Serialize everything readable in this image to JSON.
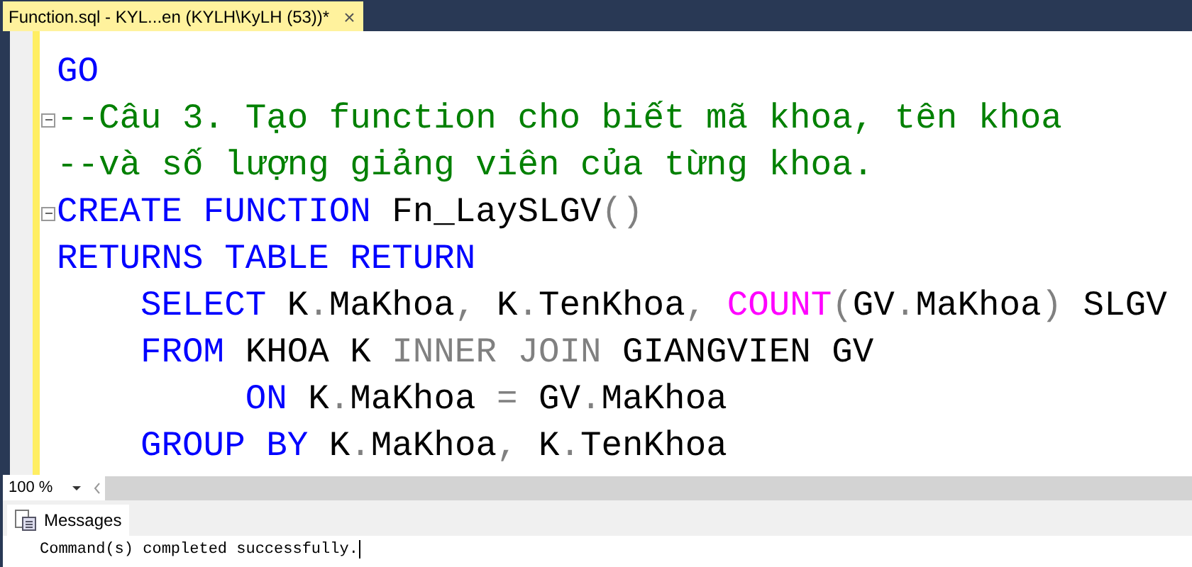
{
  "document_tab": {
    "title": "Function.sql - KYL...en (KYLH\\KyLH (53))*",
    "close": "×",
    "selected": true
  },
  "editor": {
    "lines": [
      {
        "fold": false,
        "tokens": [
          {
            "kind": "keyword",
            "text": "GO"
          }
        ]
      },
      {
        "fold": true,
        "tokens": [
          {
            "kind": "comment",
            "text": "--Câu 3. Tạo function cho biết mã khoa, tên khoa"
          }
        ]
      },
      {
        "fold": false,
        "tokens": [
          {
            "kind": "comment",
            "text": "--và số lượng giảng viên của từng khoa."
          }
        ]
      },
      {
        "fold": true,
        "tokens": [
          {
            "kind": "keyword",
            "text": "CREATE FUNCTION"
          },
          {
            "kind": "ident",
            "text": " Fn_LaySLGV"
          },
          {
            "kind": "op",
            "text": "()"
          }
        ]
      },
      {
        "fold": false,
        "tokens": [
          {
            "kind": "keyword",
            "text": "RETURNS TABLE RETURN"
          }
        ]
      },
      {
        "fold": false,
        "tokens": [
          {
            "kind": "keyword",
            "text": "    SELECT"
          },
          {
            "kind": "ident",
            "text": " K"
          },
          {
            "kind": "op",
            "text": "."
          },
          {
            "kind": "ident",
            "text": "MaKhoa"
          },
          {
            "kind": "op",
            "text": ","
          },
          {
            "kind": "ident",
            "text": " K"
          },
          {
            "kind": "op",
            "text": "."
          },
          {
            "kind": "ident",
            "text": "TenKhoa"
          },
          {
            "kind": "op",
            "text": ", "
          },
          {
            "kind": "function",
            "text": "COUNT"
          },
          {
            "kind": "op",
            "text": "("
          },
          {
            "kind": "ident",
            "text": "GV"
          },
          {
            "kind": "op",
            "text": "."
          },
          {
            "kind": "ident",
            "text": "MaKhoa"
          },
          {
            "kind": "op",
            "text": ")"
          },
          {
            "kind": "ident",
            "text": " SLGV"
          }
        ]
      },
      {
        "fold": false,
        "tokens": [
          {
            "kind": "keyword",
            "text": "    FROM"
          },
          {
            "kind": "ident",
            "text": " KHOA K "
          },
          {
            "kind": "op",
            "text": "INNER JOIN"
          },
          {
            "kind": "ident",
            "text": " GIANGVIEN GV"
          }
        ]
      },
      {
        "fold": false,
        "tokens": [
          {
            "kind": "keyword",
            "text": "         ON"
          },
          {
            "kind": "ident",
            "text": " K"
          },
          {
            "kind": "op",
            "text": "."
          },
          {
            "kind": "ident",
            "text": "MaKhoa "
          },
          {
            "kind": "op",
            "text": "="
          },
          {
            "kind": "ident",
            "text": " GV"
          },
          {
            "kind": "op",
            "text": "."
          },
          {
            "kind": "ident",
            "text": "MaKhoa"
          }
        ]
      },
      {
        "fold": false,
        "tokens": [
          {
            "kind": "keyword",
            "text": "    GROUP BY"
          },
          {
            "kind": "ident",
            "text": " K"
          },
          {
            "kind": "op",
            "text": "."
          },
          {
            "kind": "ident",
            "text": "MaKhoa"
          },
          {
            "kind": "op",
            "text": ","
          },
          {
            "kind": "ident",
            "text": " K"
          },
          {
            "kind": "op",
            "text": "."
          },
          {
            "kind": "ident",
            "text": "TenKhoa"
          }
        ]
      }
    ]
  },
  "zoom": {
    "value": "100 %"
  },
  "results": {
    "tabs": [
      {
        "label": "Messages",
        "selected": true
      }
    ],
    "message": "Command(s) completed successfully."
  }
}
